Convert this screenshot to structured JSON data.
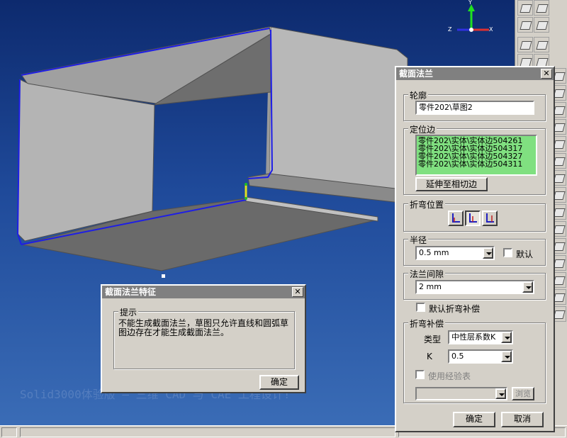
{
  "viewport": {
    "axes": {
      "y": "Y",
      "x": "X",
      "z": "Z"
    },
    "watermark": "Solid3000体验版 — 三维 CAD 与 CAE 工程设计!"
  },
  "main_dialog": {
    "title": "截面法兰",
    "profile": {
      "label": "轮廓",
      "value": "零件202\\草图2"
    },
    "locating_edge": {
      "label": "定位边",
      "items": [
        "零件202\\实体\\实体边504261",
        "零件202\\实体\\实体边504317",
        "零件202\\实体\\实体边504327",
        "零件202\\实体\\实体边504311"
      ],
      "extend_button": "延伸至相切边"
    },
    "bend_position": {
      "label": "折弯位置",
      "icons": [
        "bend-inside-icon",
        "bend-center-icon",
        "bend-outside-icon"
      ],
      "selected": 1
    },
    "radius": {
      "label": "半径",
      "value": "0.5 mm",
      "default_label": "默认"
    },
    "flange_gap": {
      "label": "法兰间隙",
      "value": "2 mm"
    },
    "default_bend_allowance": "默认折弯补偿",
    "bend_allowance": {
      "label": "折弯补偿",
      "type_label": "类型",
      "type_value": "中性层系数K",
      "k_label": "K",
      "k_value": "0.5",
      "use_table_label": "使用经验表",
      "browse_button": "浏览"
    },
    "ok_button": "确定",
    "cancel_button": "取消"
  },
  "message_dialog": {
    "title": "截面法兰特征",
    "group_label": "提示",
    "message": "不能生成截面法兰，草图只允许直线和圆弧草图边存在才能生成截面法兰。",
    "ok_button": "确定"
  },
  "colors": {
    "titlebar": "#808080",
    "edge_highlight": "#1e1ee6",
    "list_bg": "#80e080",
    "part_face": "#a8a8a8"
  }
}
